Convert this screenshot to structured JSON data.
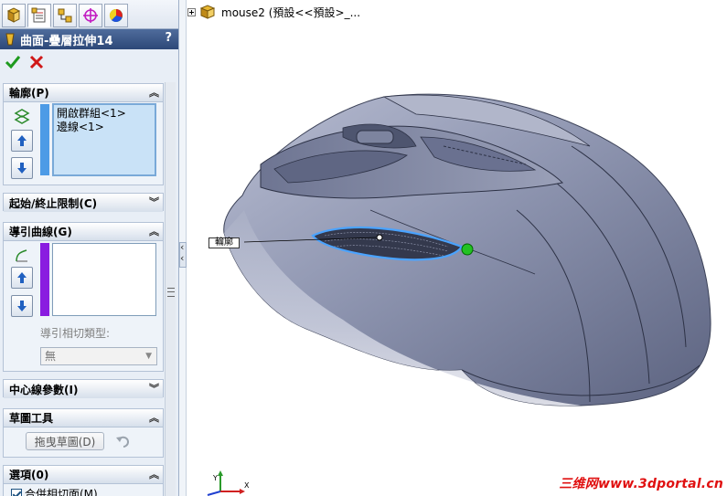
{
  "tabs": [
    {
      "name": "feature-manager",
      "icon": "feature-tree-icon"
    },
    {
      "name": "property-manager",
      "icon": "property-sheet-icon"
    },
    {
      "name": "configuration-manager",
      "icon": "configuration-icon"
    },
    {
      "name": "dimxpert-manager",
      "icon": "crosshair-icon"
    },
    {
      "name": "display-manager",
      "icon": "color-wheel-icon"
    }
  ],
  "property_manager": {
    "title": "曲面-疊層拉伸14",
    "help": "?",
    "ok_icon": "green-check-icon",
    "cancel_icon": "red-x-icon"
  },
  "groups": {
    "profile": {
      "title": "輪廓(P)",
      "items": [
        "開啟群組<1>",
        "邊線<1>"
      ],
      "bar_color": "#4d9be6"
    },
    "start_end": {
      "title": "起始/終止限制(C)"
    },
    "guide_curves": {
      "title": "導引曲線(G)",
      "bar_color": "#8a1ce0",
      "tangency_label": "導引相切類型:",
      "tangency_value": "無"
    },
    "centerline": {
      "title": "中心線參數(I)"
    },
    "sketch_tools": {
      "title": "草圖工具",
      "drag_button": "拖曳草圖(D)"
    },
    "options": {
      "title": "選項(0)",
      "merge_label": "合併相切面(M)",
      "merge_checked": true
    }
  },
  "viewport": {
    "tree_label": "mouse2 (預設<<預設>_...",
    "callout_label": "輪廓",
    "watermark": "三维网www.3dportal.cn"
  },
  "colors": {
    "accent": "#2d4878",
    "model_body": "#8e95b0",
    "selection": "#4aa3ff",
    "watermark": "#e01010"
  }
}
